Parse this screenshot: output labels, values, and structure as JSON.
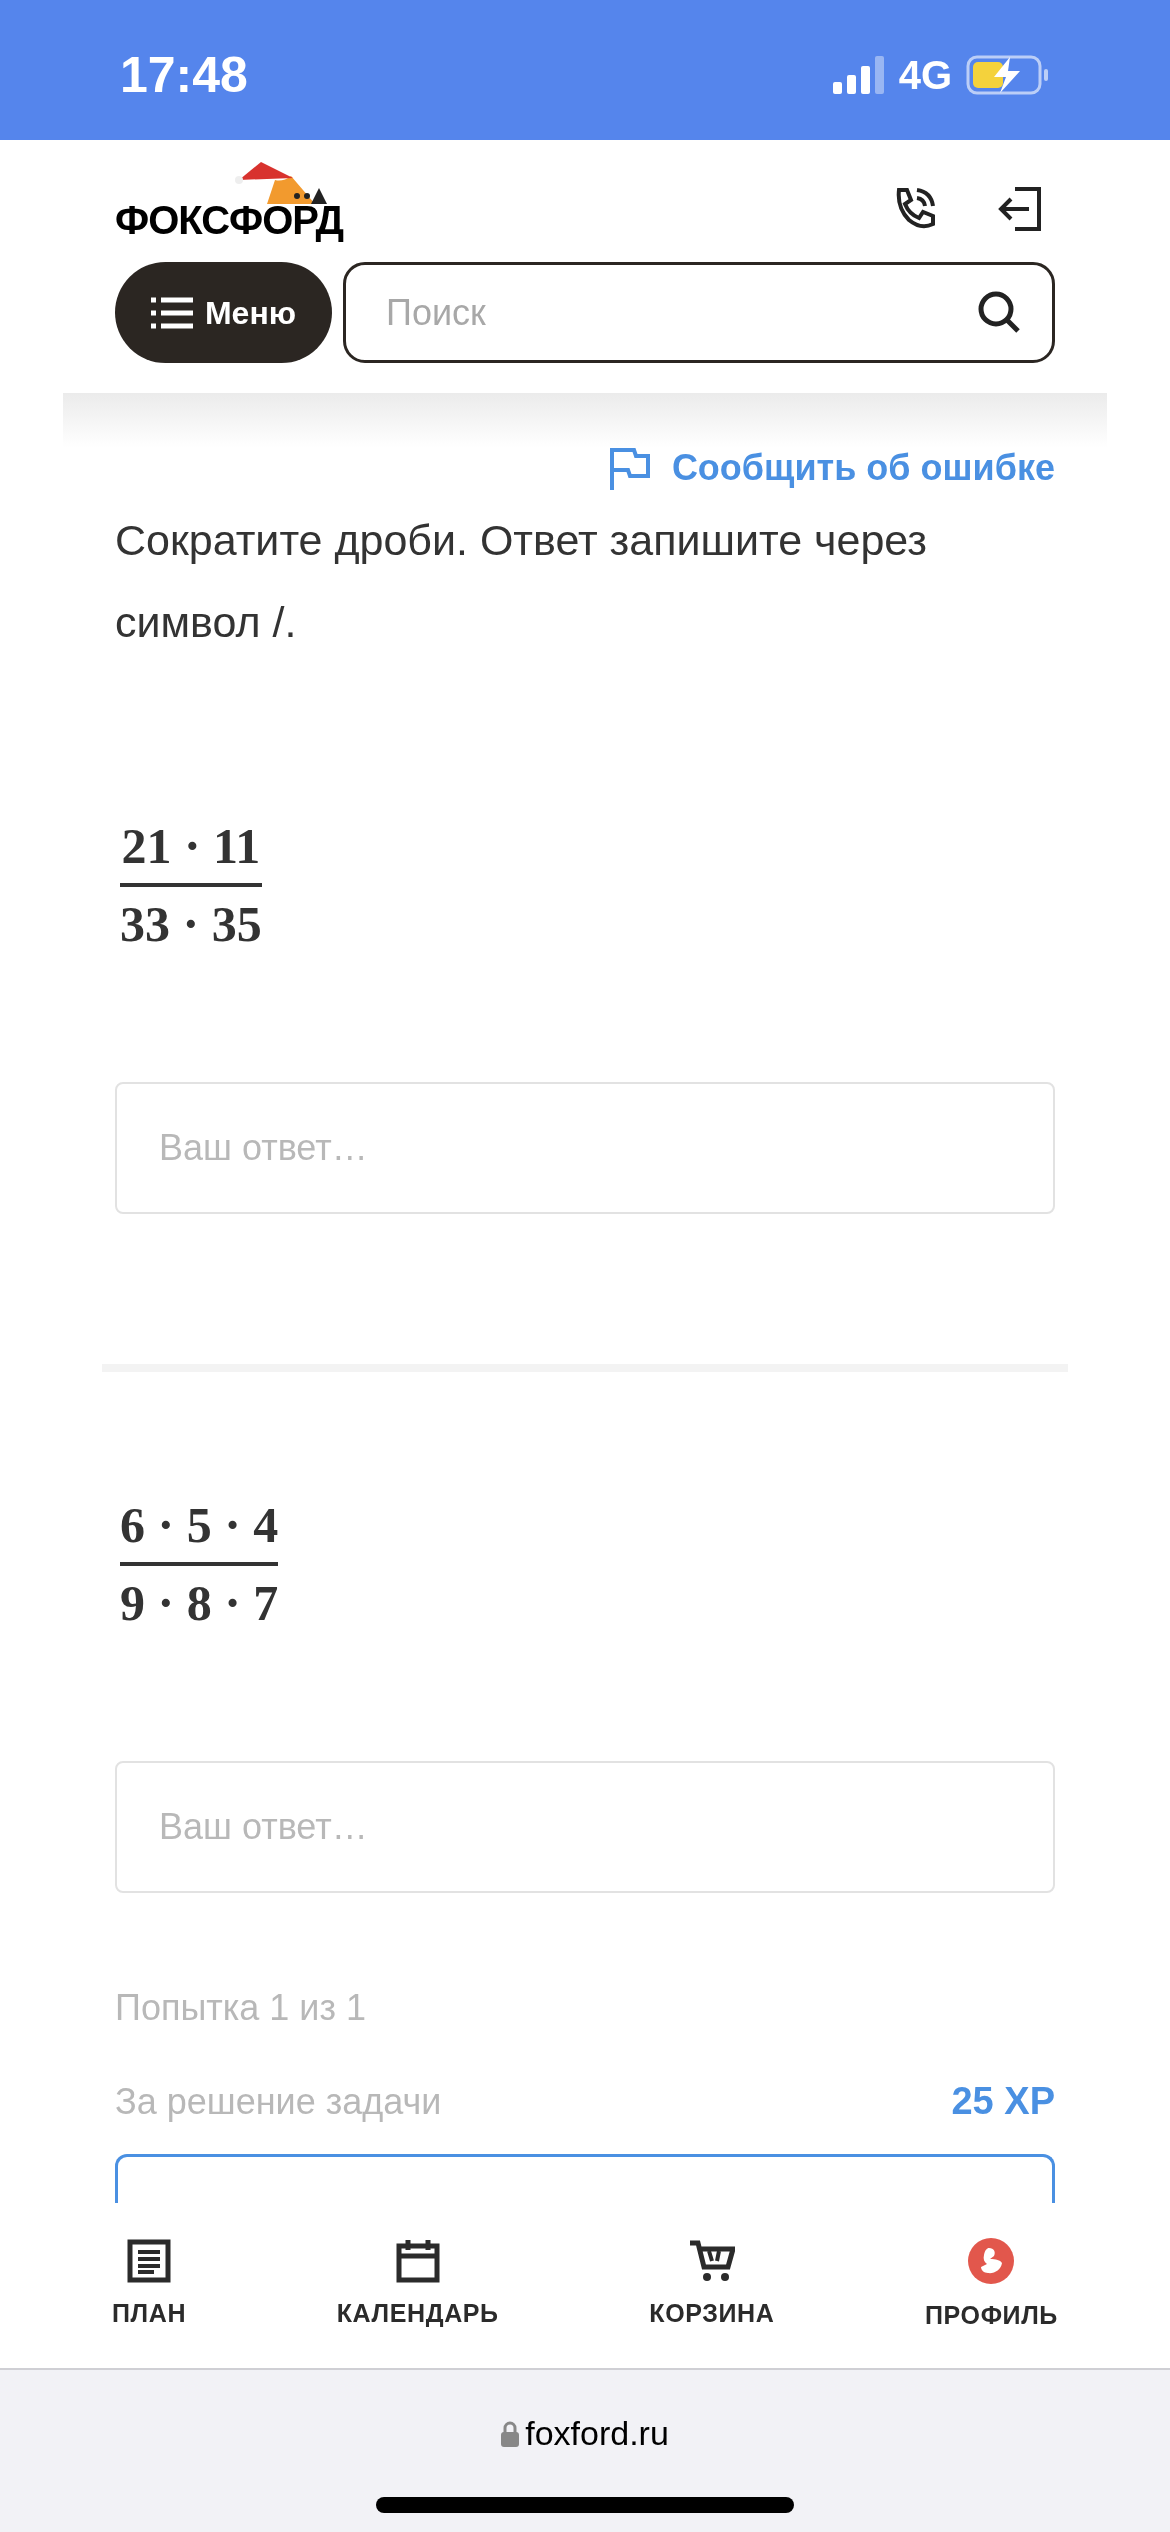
{
  "status_bar": {
    "time": "17:48",
    "network": "4G"
  },
  "header": {
    "logo": "ФОКСФОРД",
    "menu_button": "Меню",
    "search": {
      "placeholder": "Поиск"
    }
  },
  "report_link": "Сообщить об ошибке",
  "question": "Сократите дроби. Ответ запишите через символ /.",
  "tasks": [
    {
      "numerator": "21 · 11",
      "denominator": "33 · 35",
      "answer": {
        "placeholder": "Ваш ответ…"
      }
    },
    {
      "numerator": "6 · 5 · 4",
      "denominator": "9 · 8 · 7",
      "answer": {
        "placeholder": "Ваш ответ…"
      }
    }
  ],
  "attempt": "Попытка 1 из 1",
  "reward": {
    "label": "За решение задачи",
    "value": "25 XP"
  },
  "nav": [
    {
      "kind": "plan",
      "label": "ПЛАН"
    },
    {
      "kind": "calendar",
      "label": "КАЛЕНДАРЬ"
    },
    {
      "kind": "cart",
      "label": "КОРЗИНА"
    },
    {
      "kind": "profile",
      "label": "ПРОФИЛЬ"
    }
  ],
  "browser": {
    "url": "foxford.ru"
  }
}
